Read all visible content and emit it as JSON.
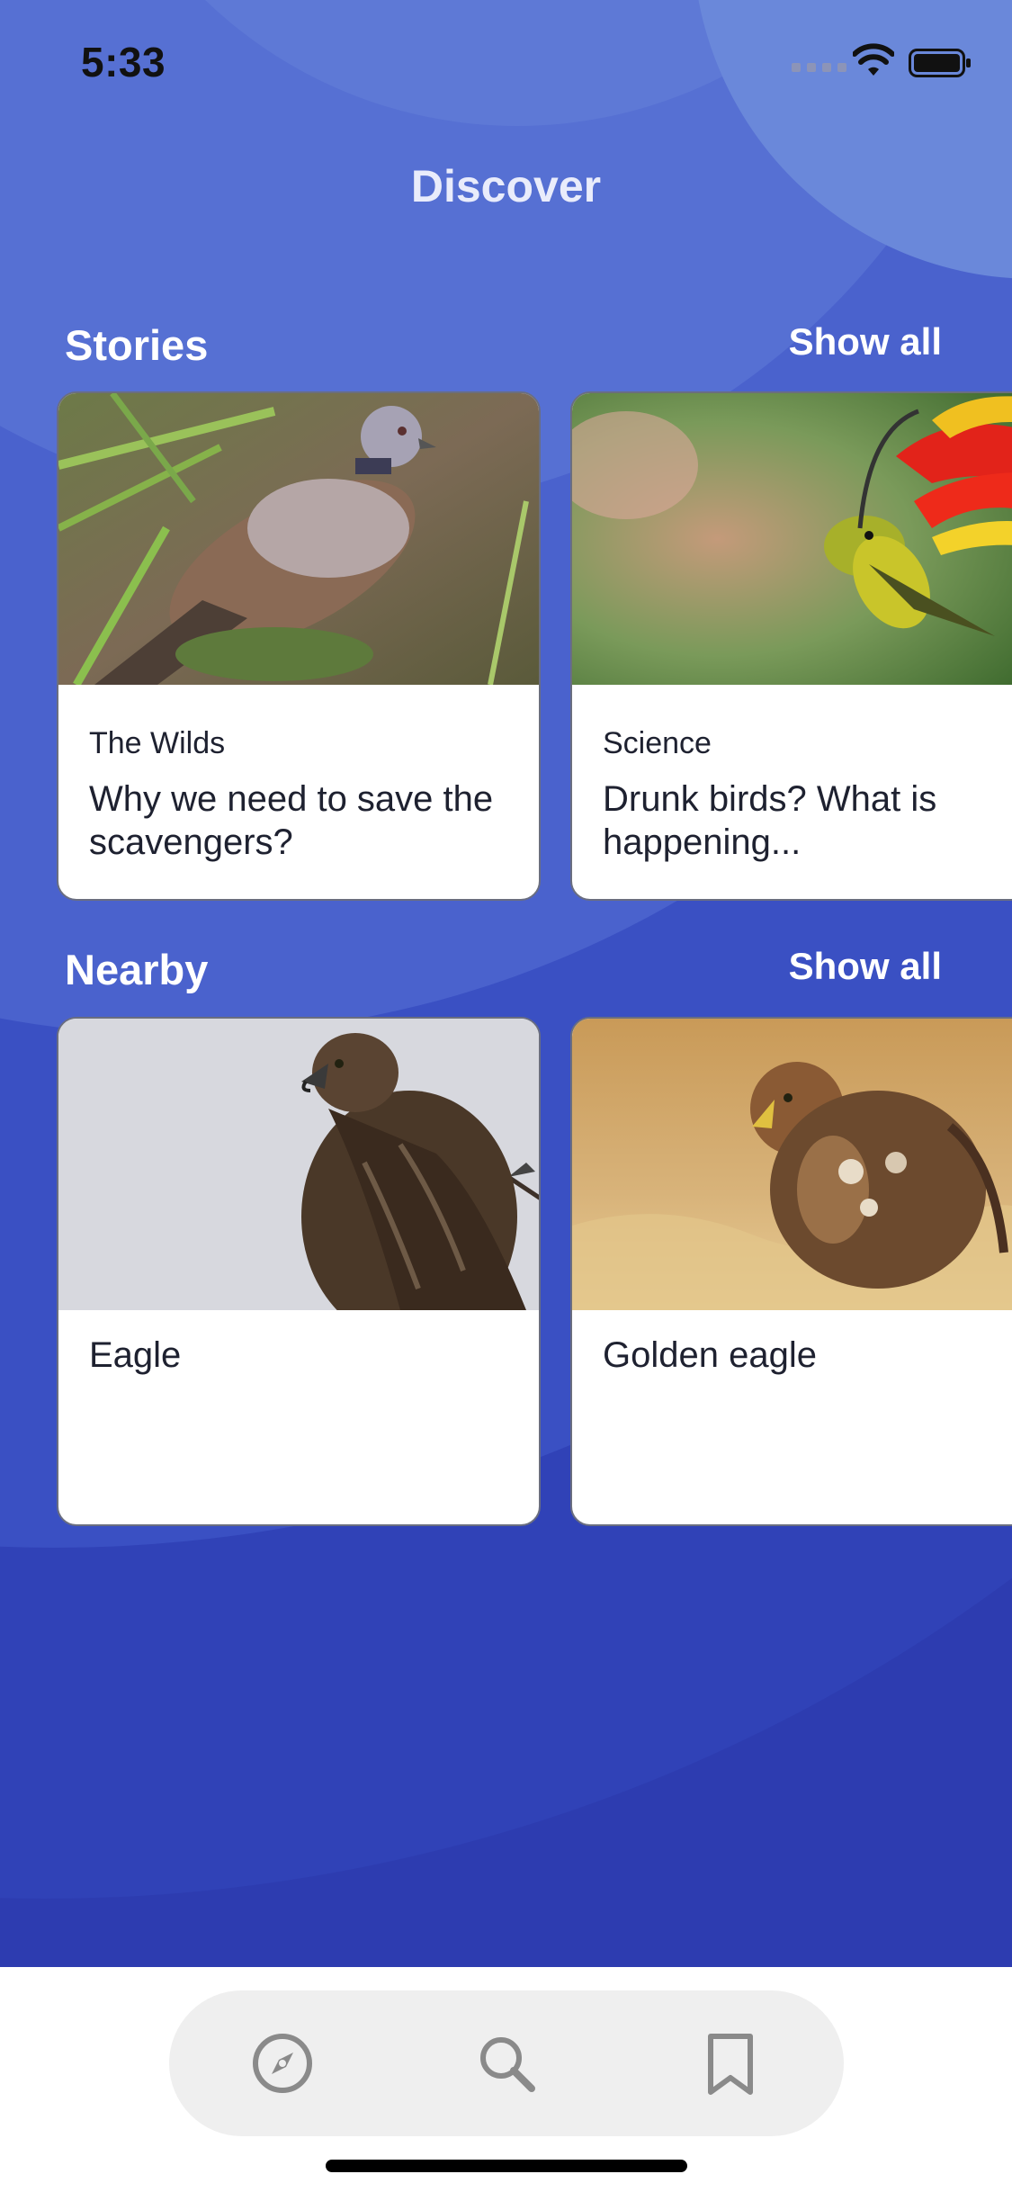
{
  "status_bar": {
    "time": "5:33"
  },
  "header": {
    "title": "Discover"
  },
  "stories": {
    "title": "Stories",
    "show_all": "Show all",
    "items": [
      {
        "category": "The Wilds",
        "title": "Why we need to save the scavengers?",
        "image": "turtle-dove-photo"
      },
      {
        "category": "Science",
        "title": "Drunk birds? What is happening...",
        "image": "sunbird-heliconia-photo"
      }
    ]
  },
  "nearby": {
    "title": "Nearby",
    "show_all": "Show all",
    "items": [
      {
        "name": "Eagle",
        "image": "steppe-eagle-photo"
      },
      {
        "name": "Golden eagle",
        "image": "golden-eagle-photo"
      }
    ]
  },
  "tab_bar": {
    "tabs": [
      {
        "icon": "compass-icon",
        "active": true
      },
      {
        "icon": "search-icon",
        "active": false
      },
      {
        "icon": "bookmark-icon",
        "active": false
      }
    ]
  },
  "colors": {
    "background": "#2d3cb0",
    "card": "#ffffff",
    "text_dark": "#1e2130",
    "tab_icon": "#8a8a8a"
  }
}
